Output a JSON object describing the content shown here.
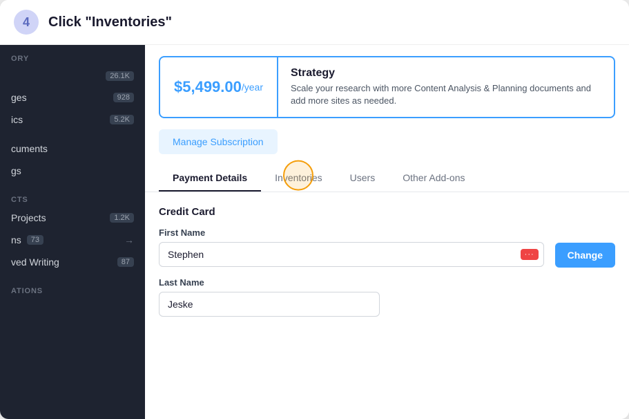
{
  "instruction": {
    "step": "4",
    "text": "Click \"Inventories\""
  },
  "sidebar": {
    "sections": [
      {
        "label": "ORY",
        "items": [
          {
            "name": "26.1K",
            "badge": "26.1K",
            "arrow": false
          },
          {
            "name": "ges",
            "label": "ges",
            "badge": "928",
            "arrow": false
          },
          {
            "name": "ics",
            "label": "ics",
            "badge": "5.2K",
            "arrow": false
          }
        ]
      },
      {
        "label": "",
        "items": [
          {
            "label": "cuments",
            "badge": null,
            "arrow": false
          },
          {
            "label": "gs",
            "badge": null,
            "arrow": false
          }
        ]
      },
      {
        "label": "CTS",
        "items": [
          {
            "label": "Projects",
            "badge": "1.2K",
            "arrow": false
          },
          {
            "label": "ns",
            "badge": "73",
            "arrow": true
          },
          {
            "label": "ved Writing",
            "badge": "87",
            "arrow": false
          }
        ]
      },
      {
        "label": "ATIONS",
        "items": []
      }
    ]
  },
  "pricing": {
    "amount": "$5,499.00",
    "period": "/year",
    "plan_name": "Strategy",
    "plan_desc": "Scale your research with more Content Analysis & Planning documents and add more sites as needed."
  },
  "manage_subscription_label": "Manage Subscription",
  "tabs": [
    {
      "id": "payment",
      "label": "Payment Details",
      "active": true
    },
    {
      "id": "inventories",
      "label": "Inventories",
      "active": false,
      "highlight": true
    },
    {
      "id": "users",
      "label": "Users",
      "active": false
    },
    {
      "id": "addons",
      "label": "Other Add-ons",
      "active": false
    }
  ],
  "form": {
    "section_title": "Credit Card",
    "first_name_label": "First Name",
    "first_name_value": "Stephen",
    "last_name_label": "Last Name",
    "last_name_value": "Jeske",
    "change_label": "Change",
    "dots_label": "···"
  }
}
